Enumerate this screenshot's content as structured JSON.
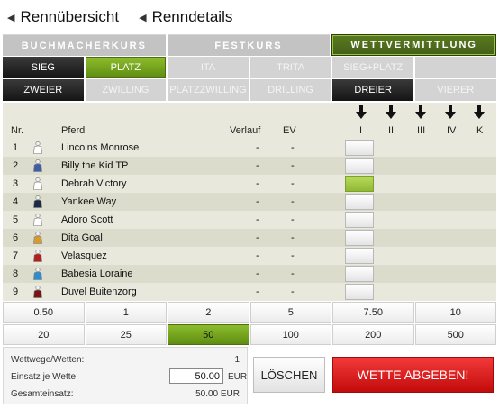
{
  "breadcrumb": [
    {
      "label": "Rennübersicht"
    },
    {
      "label": "Renndetails"
    }
  ],
  "main_tabs": [
    {
      "label": "BUCHMACHERKURS"
    },
    {
      "label": "FESTKURS"
    },
    {
      "label": "WETTVERMITTLUNG",
      "active": true
    }
  ],
  "bet_types_row1": [
    {
      "label": "SIEG",
      "style": "dark"
    },
    {
      "label": "PLATZ",
      "style": "green"
    },
    {
      "label": "ITA",
      "style": "light"
    },
    {
      "label": "TRITA",
      "style": "light"
    },
    {
      "label": "SIEG+PLATZ",
      "style": "light"
    },
    {
      "label": "",
      "style": "light"
    }
  ],
  "bet_types_row2": [
    {
      "label": "ZWEIER",
      "style": "dark"
    },
    {
      "label": "ZWILLING",
      "style": "light"
    },
    {
      "label": "PLATZZWILLING",
      "style": "light"
    },
    {
      "label": "DRILLING",
      "style": "light"
    },
    {
      "label": "DREIER",
      "style": "dark"
    },
    {
      "label": "VIERER",
      "style": "light"
    }
  ],
  "table": {
    "headers": {
      "nr": "Nr.",
      "pferd": "Pferd",
      "verlauf": "Verlauf",
      "ev": "EV",
      "cols": [
        "I",
        "II",
        "III",
        "IV",
        "K"
      ]
    },
    "rows": [
      {
        "nr": "1",
        "pferd": "Lincolns Monrose",
        "verlauf": "-",
        "ev": "-",
        "jockey_color": "#ffffff",
        "selected": false
      },
      {
        "nr": "2",
        "pferd": "Billy the Kid TP",
        "verlauf": "-",
        "ev": "-",
        "jockey_color": "#3d5fa8",
        "selected": false
      },
      {
        "nr": "3",
        "pferd": "Debrah Victory",
        "verlauf": "-",
        "ev": "-",
        "jockey_color": "#ffffff",
        "selected": true
      },
      {
        "nr": "4",
        "pferd": "Yankee Way",
        "verlauf": "-",
        "ev": "-",
        "jockey_color": "#1c2a4a",
        "selected": false
      },
      {
        "nr": "5",
        "pferd": "Adoro Scott",
        "verlauf": "-",
        "ev": "-",
        "jockey_color": "#ffffff",
        "selected": false
      },
      {
        "nr": "6",
        "pferd": "Dita Goal",
        "verlauf": "-",
        "ev": "-",
        "jockey_color": "#d89a2a",
        "selected": false
      },
      {
        "nr": "7",
        "pferd": "Velasquez",
        "verlauf": "-",
        "ev": "-",
        "jockey_color": "#b31e1e",
        "selected": false
      },
      {
        "nr": "8",
        "pferd": "Babesia Loraine",
        "verlauf": "-",
        "ev": "-",
        "jockey_color": "#2a8fd0",
        "selected": false
      },
      {
        "nr": "9",
        "pferd": "Duvel Buitenzorg",
        "verlauf": "-",
        "ev": "-",
        "jockey_color": "#7a1414",
        "selected": false
      }
    ]
  },
  "stakes_row1": [
    {
      "label": "0.50"
    },
    {
      "label": "1"
    },
    {
      "label": "2"
    },
    {
      "label": "5"
    },
    {
      "label": "7.50"
    },
    {
      "label": "10"
    }
  ],
  "stakes_row2": [
    {
      "label": "20"
    },
    {
      "label": "25"
    },
    {
      "label": "50",
      "active": true
    },
    {
      "label": "100"
    },
    {
      "label": "200"
    },
    {
      "label": "500"
    }
  ],
  "summary": {
    "wettwege_label": "Wettwege/Wetten:",
    "wettwege_value": "1",
    "einsatz_label": "Einsatz je Wette:",
    "einsatz_value": "50.00",
    "einsatz_currency": "EUR",
    "gesamt_label": "Gesamteinsatz:",
    "gesamt_value": "50.00 EUR"
  },
  "actions": {
    "loeschen": "LÖSCHEN",
    "abgeben": "WETTE ABGEBEN!"
  },
  "colors": {
    "accent_green": "#7aa821",
    "dark": "#1e1e1e",
    "danger": "#e02020"
  }
}
